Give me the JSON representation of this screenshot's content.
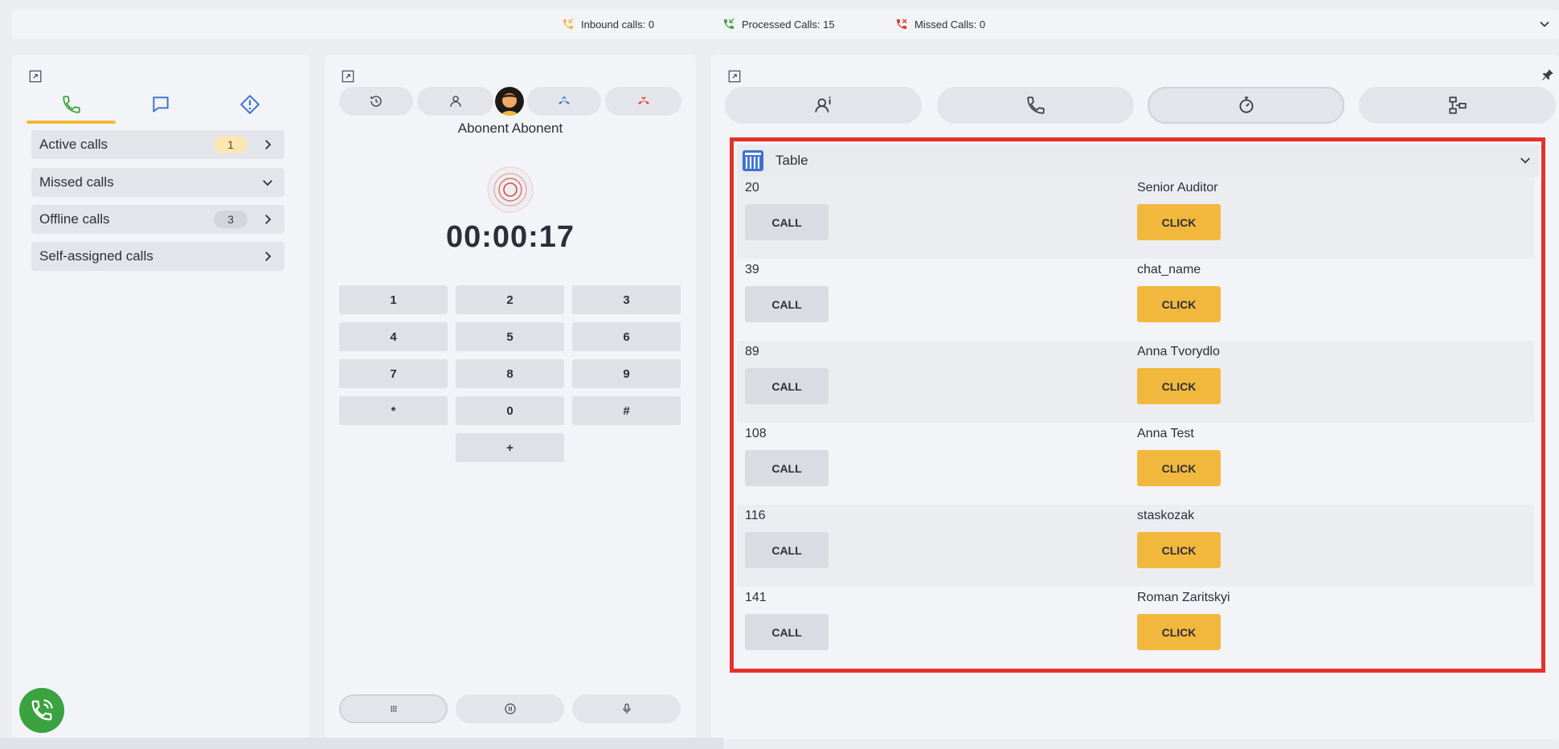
{
  "topbar": {
    "inbound": "Inbound calls: 0",
    "processed": "Processed Calls: 15",
    "missed": "Missed Calls: 0",
    "colors": {
      "inbound": "#f0b93b",
      "processed": "#3aa23f",
      "missed": "#e4322b"
    }
  },
  "left": {
    "tabs": [
      {
        "icon": "phone-icon",
        "active": true
      },
      {
        "icon": "chat-icon",
        "active": false
      },
      {
        "icon": "alert-diamond-icon",
        "active": false
      }
    ],
    "items": [
      {
        "label": "Active calls",
        "badge": "1"
      },
      {
        "label": "Missed calls"
      },
      {
        "label": "Offline calls",
        "badge": "3"
      },
      {
        "label": "Self-assigned calls"
      }
    ]
  },
  "dialer": {
    "contact": "Abonent Abonent",
    "timer": "00:00:17",
    "keys": [
      "1",
      "2",
      "3",
      "4",
      "5",
      "6",
      "7",
      "8",
      "9",
      "*",
      "0",
      "#",
      "+"
    ]
  },
  "right": {
    "table_title": "Table",
    "rows": [
      {
        "id": "20",
        "name": "Senior Auditor",
        "call": "CALL",
        "click": "CLICK"
      },
      {
        "id": "39",
        "name": "chat_name",
        "call": "CALL",
        "click": "CLICK"
      },
      {
        "id": "89",
        "name": "Anna Tvorydlo",
        "call": "CALL",
        "click": "CLICK"
      },
      {
        "id": "108",
        "name": "Anna Test",
        "call": "CALL",
        "click": "CLICK"
      },
      {
        "id": "116",
        "name": "staskozak",
        "call": "CALL",
        "click": "CLICK"
      },
      {
        "id": "141",
        "name": "Roman Zaritskyi",
        "call": "CALL",
        "click": "CLICK"
      }
    ]
  }
}
